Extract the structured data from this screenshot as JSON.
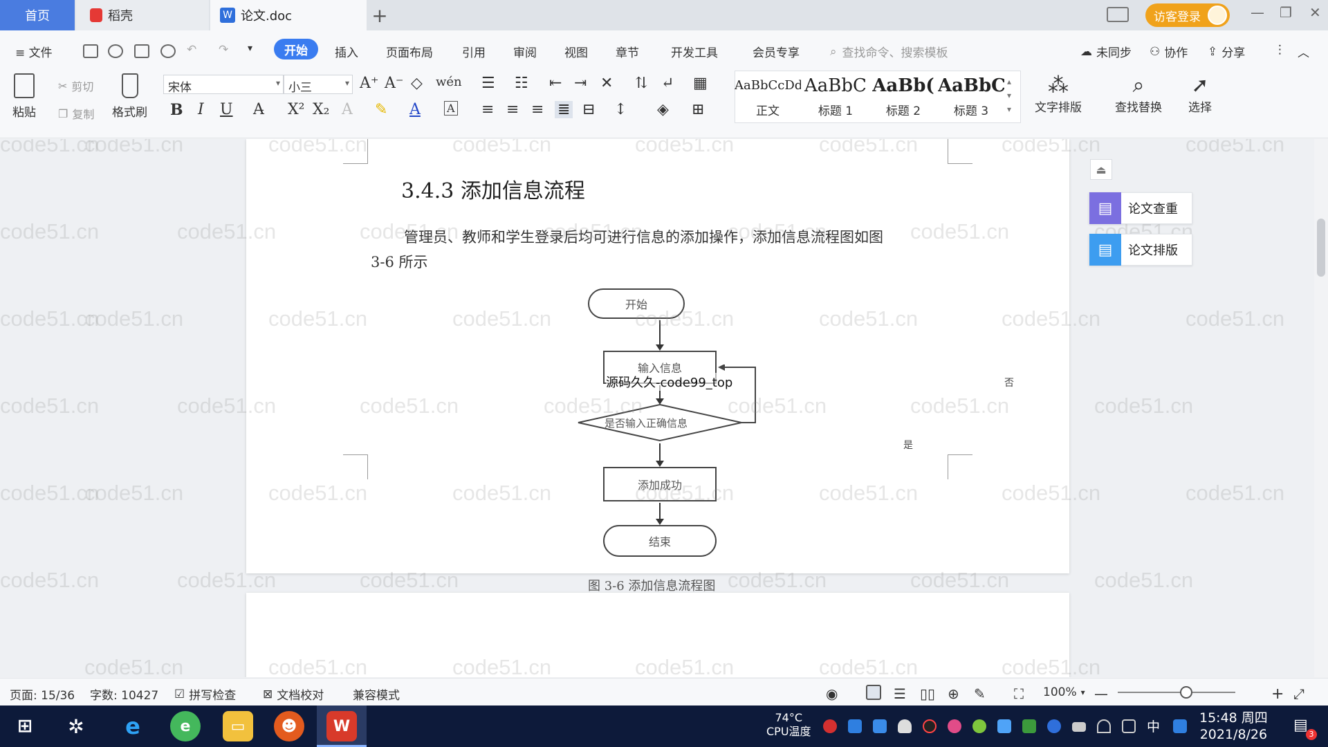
{
  "tabs": {
    "home": "首页",
    "daoke": "稻壳",
    "doc": "论文.doc",
    "add": "+"
  },
  "titlebar": {
    "login": "访客登录",
    "minimize": "—",
    "restore": "❐",
    "close": "✕"
  },
  "menu": {
    "file": "文件",
    "start": "开始",
    "insert": "插入",
    "layout": "页面布局",
    "reference": "引用",
    "review": "审阅",
    "view": "视图",
    "chapter": "章节",
    "devtools": "开发工具",
    "member": "会员专享",
    "search_placeholder": "查找命令、搜索模板",
    "sync": "未同步",
    "collab": "协作",
    "share": "分享"
  },
  "ribbon": {
    "paste": "粘贴",
    "cut": "剪切",
    "copy": "复制",
    "format_painter": "格式刷",
    "font_name": "宋体",
    "font_size": "小三",
    "bold": "B",
    "italic": "I",
    "underline": "U",
    "styles": [
      {
        "sample": "AaBbCcDd",
        "label": "正文"
      },
      {
        "sample": "AaBbC",
        "label": "标题 1"
      },
      {
        "sample": "AaBb(",
        "label": "标题 2"
      },
      {
        "sample": "AaBbC",
        "label": "标题 3"
      }
    ],
    "text_layout": "文字排版",
    "find_replace": "查找替换",
    "select": "选择"
  },
  "document": {
    "heading": "3.4.3 添加信息流程",
    "paragraph_line1": "管理员、教师和学生登录后均可进行信息的添加操作，添加信息流程图如图",
    "paragraph_line2": "3-6 所示",
    "flowchart": {
      "start": "开始",
      "input": "输入信息",
      "decision": "是否输入正确信息",
      "success": "添加成功",
      "end": "结束",
      "yes": "是",
      "no": "否",
      "overlay": "源码久久-code99_top"
    },
    "caption": "图 3-6 添加信息流程图"
  },
  "side_panel": {
    "check": "论文查重",
    "format": "论文排版"
  },
  "watermark_text": "code51.cn",
  "statusbar": {
    "page": "页面: 15/36",
    "words": "字数: 10427",
    "spell": "拼写检查",
    "proof": "文档校对",
    "compat": "兼容模式",
    "zoom": "100%"
  },
  "taskbar": {
    "cpu_temp": "74°C",
    "cpu_label": "CPU温度",
    "ime": "中",
    "time": "15:48 周四",
    "date": "2021/8/26",
    "notif_count": "3"
  },
  "colors": {
    "accent": "#3a7cf0",
    "tab_home": "#4a7ce0",
    "login": "#f0a21b",
    "check_icon": "#7b6fe0",
    "format_icon": "#3d9df0",
    "taskbar": "#0d1a3a"
  }
}
